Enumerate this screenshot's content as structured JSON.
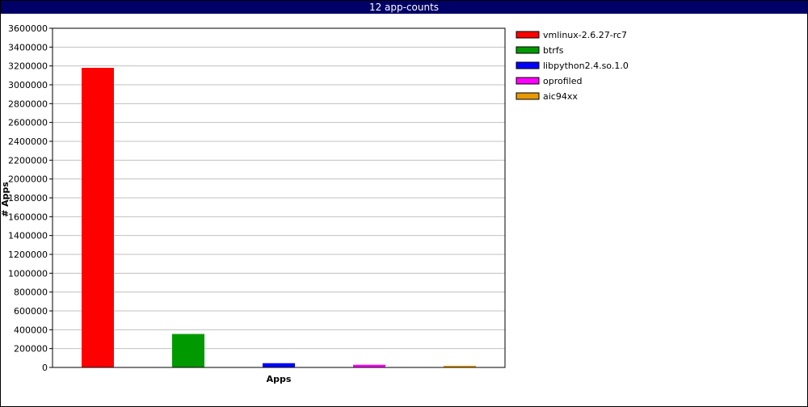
{
  "chart_data": {
    "type": "bar",
    "title": "12 app-counts",
    "xlabel": "Apps",
    "ylabel": "# Apps",
    "ylim": [
      0,
      3600000
    ],
    "yticks": [
      "0",
      "200000",
      "400000",
      "600000",
      "800000",
      "1000000",
      "1200000",
      "1400000",
      "1600000",
      "1800000",
      "2000000",
      "2200000",
      "2400000",
      "2600000",
      "2800000",
      "3000000",
      "3200000",
      "3400000",
      "3600000"
    ],
    "grid": true,
    "legend_position": "right",
    "series": [
      {
        "name": "vmlinux-2.6.27-rc7",
        "value": 3180000,
        "color": "#ff0000"
      },
      {
        "name": "btrfs",
        "value": 355000,
        "color": "#009900"
      },
      {
        "name": "libpython2.4.so.1.0",
        "value": 45000,
        "color": "#0000ff"
      },
      {
        "name": "oprofiled",
        "value": 28000,
        "color": "#ff00ff"
      },
      {
        "name": "aic94xx",
        "value": 18000,
        "color": "#e69900"
      }
    ]
  }
}
